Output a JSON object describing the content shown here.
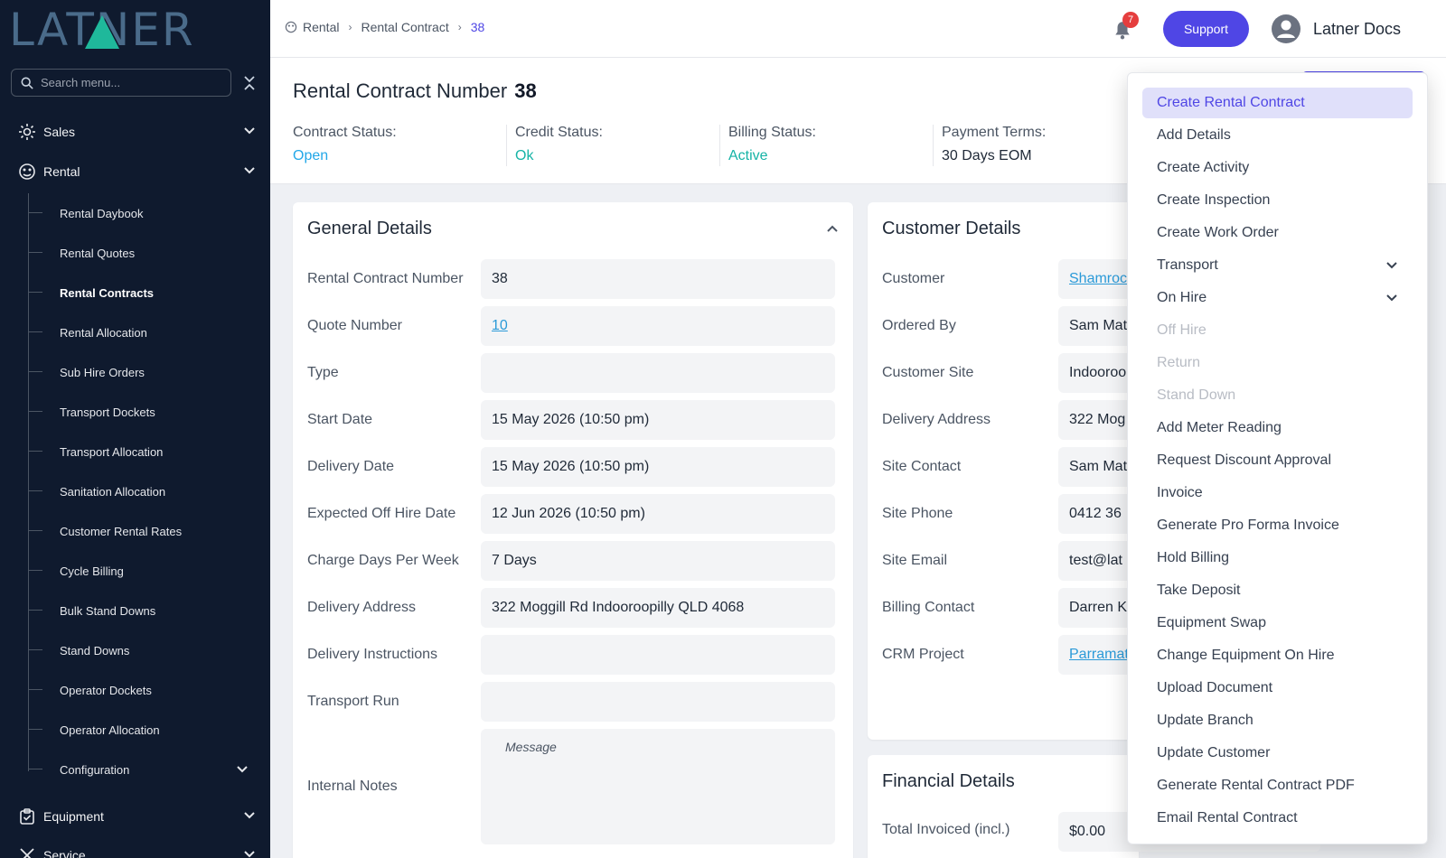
{
  "app": {
    "logo_text": "LATNER",
    "user_name": "Latner Docs",
    "notifications_count": "7",
    "support_label": "Support"
  },
  "sidebar": {
    "search_placeholder": "Search menu...",
    "sections": [
      {
        "label": "Sales"
      },
      {
        "label": "Rental"
      },
      {
        "label": "Equipment"
      },
      {
        "label": "Service"
      }
    ],
    "rental_items": [
      {
        "label": "Rental Daybook"
      },
      {
        "label": "Rental Quotes"
      },
      {
        "label": "Rental Contracts"
      },
      {
        "label": "Rental Allocation"
      },
      {
        "label": "Sub Hire Orders"
      },
      {
        "label": "Transport Dockets"
      },
      {
        "label": "Transport Allocation"
      },
      {
        "label": "Sanitation Allocation"
      },
      {
        "label": "Customer Rental Rates"
      },
      {
        "label": "Cycle Billing"
      },
      {
        "label": "Bulk Stand Downs"
      },
      {
        "label": "Stand Downs"
      },
      {
        "label": "Operator Dockets"
      },
      {
        "label": "Operator Allocation"
      },
      {
        "label": "Configuration"
      }
    ]
  },
  "breadcrumb": {
    "items": [
      "Rental",
      "Rental Contract"
    ],
    "current": "38"
  },
  "header": {
    "title": "Rental Contract Number",
    "number": "38",
    "statuses": [
      {
        "label": "Contract Status:",
        "value": "Open",
        "color": "#22a7e8"
      },
      {
        "label": "Credit Status:",
        "value": "Ok",
        "color": "#16b3a6"
      },
      {
        "label": "Billing Status:",
        "value": "Active",
        "color": "#16b3a6"
      },
      {
        "label": "Payment Terms:",
        "value": "30 Days EOM",
        "color": "#1f2937"
      }
    ]
  },
  "general": {
    "title": "General Details",
    "rows": [
      {
        "label": "Rental Contract Number",
        "value": "38"
      },
      {
        "label": "Quote Number",
        "value": "10"
      },
      {
        "label": "Type",
        "value": ""
      },
      {
        "label": "Start Date",
        "value": "15 May 2026 (10:50 pm)"
      },
      {
        "label": "Delivery Date",
        "value": "15 May 2026 (10:50 pm)"
      },
      {
        "label": "Expected Off Hire Date",
        "value": "12 Jun 2026 (10:50 pm)"
      },
      {
        "label": "Charge Days Per Week",
        "value": "7 Days"
      },
      {
        "label": "Delivery Address",
        "value": "322 Moggill Rd Indooroopilly QLD 4068"
      },
      {
        "label": "Delivery Instructions",
        "value": ""
      },
      {
        "label": "Transport Run",
        "value": ""
      }
    ],
    "notes_label": "Internal Notes",
    "notes_placeholder": "Message"
  },
  "customer": {
    "title": "Customer Details",
    "rows": [
      {
        "label": "Customer",
        "value": "Shamrock"
      },
      {
        "label": "Ordered By",
        "value": "Sam Mat"
      },
      {
        "label": "Customer Site",
        "value": "Indooroo"
      },
      {
        "label": "Delivery Address",
        "value": "322 Mog"
      },
      {
        "label": "Site Contact",
        "value": "Sam Mat"
      },
      {
        "label": "Site Phone",
        "value": "0412 36"
      },
      {
        "label": "Site Email",
        "value": "test@lat"
      },
      {
        "label": "Billing Contact",
        "value": "Darren K"
      },
      {
        "label": "CRM Project",
        "value": "Parramat"
      }
    ]
  },
  "financial": {
    "title": "Financial Details",
    "rows": [
      {
        "label": "Total Invoiced (incl.)",
        "value": "$0.00"
      }
    ]
  },
  "actions_menu": {
    "items": [
      {
        "label": "Create Rental Contract"
      },
      {
        "label": "Add Details"
      },
      {
        "label": "Create Activity"
      },
      {
        "label": "Create Inspection"
      },
      {
        "label": "Create Work Order"
      },
      {
        "label": "Transport"
      },
      {
        "label": "On Hire"
      },
      {
        "label": "Off Hire"
      },
      {
        "label": "Return"
      },
      {
        "label": "Stand Down"
      },
      {
        "label": "Add Meter Reading"
      },
      {
        "label": "Request Discount Approval"
      },
      {
        "label": "Invoice"
      },
      {
        "label": "Generate Pro Forma Invoice"
      },
      {
        "label": "Hold Billing"
      },
      {
        "label": "Take Deposit"
      },
      {
        "label": "Equipment Swap"
      },
      {
        "label": "Change Equipment On Hire"
      },
      {
        "label": "Upload Document"
      },
      {
        "label": "Update Branch"
      },
      {
        "label": "Update Customer"
      },
      {
        "label": "Generate Rental Contract PDF"
      },
      {
        "label": "Email Rental Contract"
      }
    ]
  },
  "colors": {
    "accent": "#4f46e5",
    "sidebar_bg": "#0f1a2e",
    "logo_teal": "#1fb89b",
    "link": "#2b9ad8"
  }
}
